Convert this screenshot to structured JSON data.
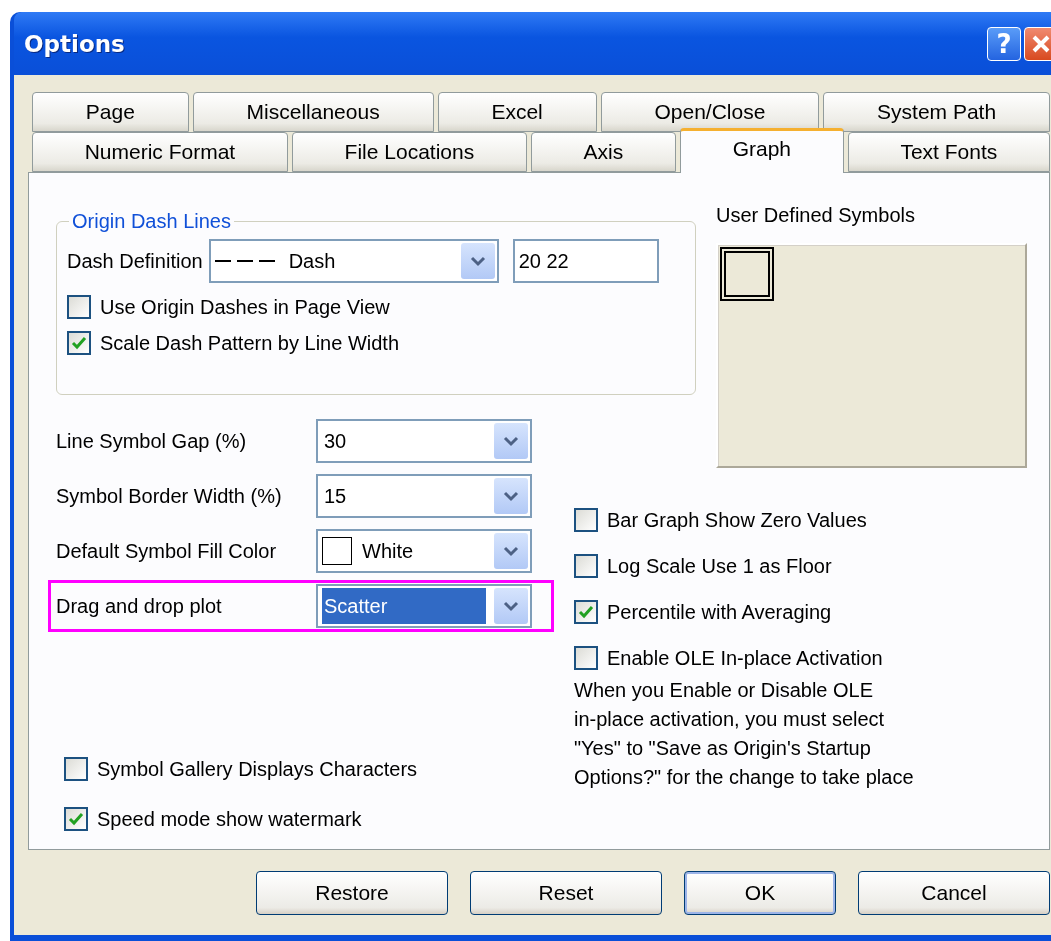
{
  "window": {
    "title": "Options",
    "help_label": "?"
  },
  "tabs": [
    [
      {
        "label": "Page",
        "selected": false
      },
      {
        "label": "Miscellaneous",
        "selected": false
      },
      {
        "label": "Excel",
        "selected": false
      },
      {
        "label": "Open/Close",
        "selected": false
      },
      {
        "label": "System Path",
        "selected": false
      }
    ],
    [
      {
        "label": "Numeric Format",
        "selected": false
      },
      {
        "label": "File Locations",
        "selected": false
      },
      {
        "label": "Axis",
        "selected": false
      },
      {
        "label": "Graph",
        "selected": true
      },
      {
        "label": "Text Fonts",
        "selected": false
      }
    ]
  ],
  "dash_group": {
    "title": "Origin Dash Lines",
    "definition_label": "Dash Definition",
    "definition_value": "Dash",
    "definition_text": "20 22",
    "checkboxes": [
      {
        "label": "Use Origin Dashes in Page View",
        "checked": false
      },
      {
        "label": "Scale Dash Pattern by Line Width",
        "checked": true
      }
    ]
  },
  "user_symbols": {
    "title": "User Defined Symbols"
  },
  "settings": [
    {
      "label": "Line Symbol Gap (%)",
      "value": "30",
      "kind": "text",
      "focused": false,
      "highlighted": false
    },
    {
      "label": "Symbol Border Width (%)",
      "value": "15",
      "kind": "text",
      "focused": false,
      "highlighted": false
    },
    {
      "label": "Default Symbol Fill Color",
      "value": "White",
      "kind": "color",
      "color": "#ffffff",
      "focused": false,
      "highlighted": false
    },
    {
      "label": "Drag and drop plot",
      "value": "Scatter",
      "kind": "text",
      "focused": true,
      "highlighted": true
    }
  ],
  "left_checkboxes": [
    {
      "label": "Symbol Gallery Displays Characters",
      "checked": false
    },
    {
      "label": "Speed mode show watermark",
      "checked": true
    }
  ],
  "right_checkboxes": [
    {
      "label": "Bar Graph Show Zero Values",
      "checked": false
    },
    {
      "label": "Log Scale Use 1 as Floor",
      "checked": false
    },
    {
      "label": "Percentile with Averaging",
      "checked": true
    },
    {
      "label": "Enable OLE In-place Activation",
      "checked": false
    }
  ],
  "ole_note": "When you Enable or Disable OLE\nin-place activation, you must select\n\"Yes\" to \"Save as Origin's Startup\nOptions?\" for the change to take place",
  "buttons": [
    {
      "label": "Restore",
      "default": false
    },
    {
      "label": "Reset",
      "default": false
    },
    {
      "label": "OK",
      "default": true
    },
    {
      "label": "Cancel",
      "default": false
    }
  ]
}
